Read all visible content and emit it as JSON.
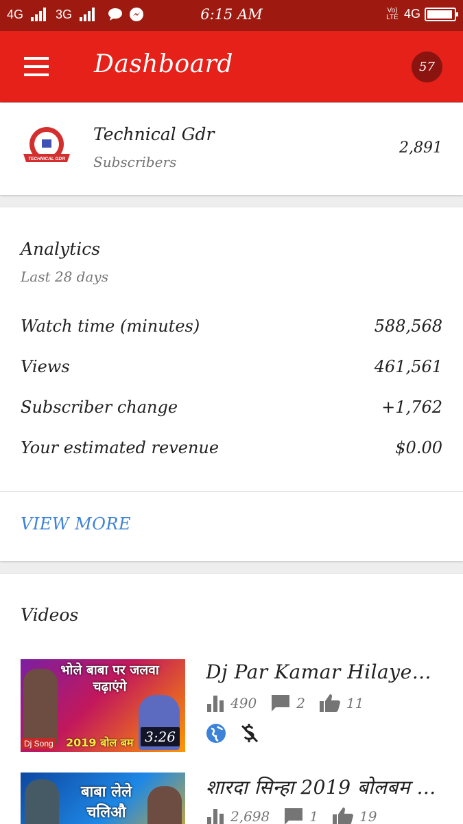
{
  "status_bar": {
    "network_1": "4G",
    "network_2": "3G",
    "time": "6:15 AM",
    "volte": "Vo) LTE",
    "network_right": "4G",
    "battery_level": 0.95
  },
  "app_bar": {
    "title": "Dashboard",
    "notification_count": "57"
  },
  "channel": {
    "name": "Technical Gdr",
    "subscribers_label": "Subscribers",
    "subscribers_count": "2,891",
    "logo_text": "TECHNICAL GDR"
  },
  "analytics": {
    "title": "Analytics",
    "period": "Last 28 days",
    "metrics": [
      {
        "label": "Watch time (minutes)",
        "value": "588,568"
      },
      {
        "label": "Views",
        "value": "461,561"
      },
      {
        "label": "Subscriber change",
        "value": "+1,762"
      },
      {
        "label": "Your estimated revenue",
        "value": "$0.00"
      }
    ],
    "view_more": "VIEW MORE"
  },
  "videos": {
    "title": "Videos",
    "items": [
      {
        "title": "Dj Par Kamar Hilayenge...",
        "duration": "3:26",
        "views": "490",
        "comments": "2",
        "likes": "11",
        "thumb_text": "भोले बाबा पर जलवा चढ़ाएंगे",
        "thumb_tag": "Dj Song",
        "thumb_year": "2019 बोल बम"
      },
      {
        "title": "शारदा सिन्हा 2019 बोलबम गा...",
        "views": "2,698",
        "comments": "1",
        "likes": "19",
        "thumb_text": "बाबा लेले चलिऔ"
      }
    ]
  },
  "colors": {
    "app_bar": "#e52119",
    "status_bar": "#9e1a10",
    "badge": "#8b1410",
    "link": "#3b82d8"
  }
}
